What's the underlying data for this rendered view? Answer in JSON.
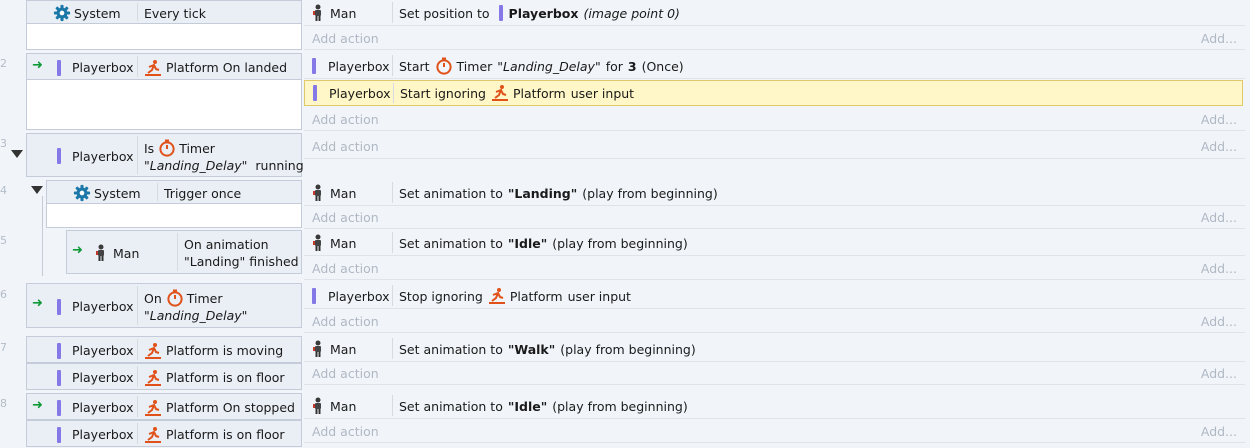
{
  "add_action": "Add action",
  "add_more": "Add...",
  "events": {
    "e1": {
      "num": "",
      "cond": {
        "object": "System",
        "text": "Every tick"
      },
      "actions": [
        {
          "object": "Man",
          "prefix": "Set position to",
          "target": "Playerbox",
          "suffix": "(image point 0)"
        }
      ]
    },
    "e2": {
      "num": "2",
      "cond": {
        "object": "Playerbox",
        "text": "Platform On landed"
      },
      "actions": [
        {
          "object": "Playerbox",
          "prefix": "Start",
          "behavior": "Timer",
          "name": "\"Landing_Delay\"",
          "mid": "for",
          "value": "3",
          "suffix": "(Once)"
        },
        {
          "object": "Playerbox",
          "prefix": "Start ignoring",
          "behavior": "Platform",
          "suffix": "user input"
        }
      ]
    },
    "e3": {
      "num": "3",
      "cond": {
        "object": "Playerbox",
        "prefix": "Is",
        "behavior": "Timer",
        "name": "\"Landing_Delay\"",
        "suffix": "running"
      }
    },
    "e4": {
      "num": "4",
      "cond": {
        "object": "System",
        "text": "Trigger once"
      },
      "actions": [
        {
          "object": "Man",
          "prefix": "Set animation to",
          "value": "\"Landing\"",
          "suffix": "(play from beginning)"
        }
      ]
    },
    "e5": {
      "num": "5",
      "cond": {
        "object": "Man",
        "line1": "On animation",
        "line2": "\"Landing\" finished"
      },
      "actions": [
        {
          "object": "Man",
          "prefix": "Set animation to",
          "value": "\"Idle\"",
          "suffix": "(play from beginning)"
        }
      ]
    },
    "e6": {
      "num": "6",
      "cond": {
        "object": "Playerbox",
        "prefix": "On",
        "behavior": "Timer",
        "name": "\"Landing_Delay\""
      },
      "actions": [
        {
          "object": "Playerbox",
          "prefix": "Stop ignoring",
          "behavior": "Platform",
          "suffix": "user input"
        }
      ]
    },
    "e7": {
      "num": "7",
      "conds": [
        {
          "object": "Playerbox",
          "text": "Platform is moving"
        },
        {
          "object": "Playerbox",
          "text": "Platform is on floor"
        }
      ],
      "actions": [
        {
          "object": "Man",
          "prefix": "Set animation to",
          "value": "\"Walk\"",
          "suffix": "(play from beginning)"
        }
      ]
    },
    "e8": {
      "num": "8",
      "conds": [
        {
          "object": "Playerbox",
          "text": "Platform On stopped"
        },
        {
          "object": "Playerbox",
          "text": "Platform is on floor"
        }
      ],
      "actions": [
        {
          "object": "Man",
          "prefix": "Set animation to",
          "value": "\"Idle\"",
          "suffix": "(play from beginning)"
        }
      ]
    }
  },
  "icons": {
    "gear": "gear-icon",
    "sprite_bar": "sprite-icon",
    "man": "man-sprite-icon",
    "platform": "platform-behavior-icon",
    "timer": "timer-behavior-icon",
    "trigger": "trigger-arrow-icon",
    "collapse": "collapse-arrow-icon"
  },
  "colors": {
    "background": "#f1f5fa",
    "selected_row": "#fff7c7",
    "sprite_bar": "#8579e8",
    "behavior": "#e0521a",
    "gear": "#1b78a8",
    "trigger": "#0f9a37"
  }
}
